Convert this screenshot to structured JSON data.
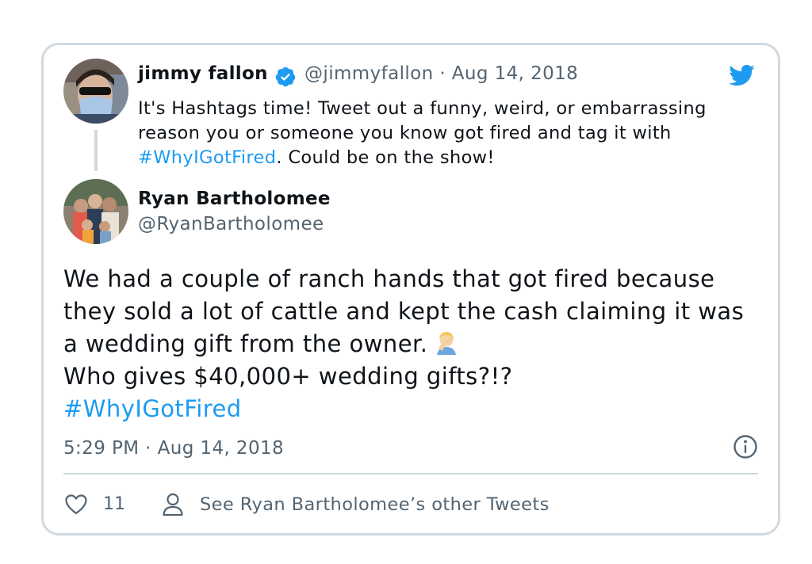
{
  "parent_tweet": {
    "author_name": "jimmy fallon",
    "meta": "@jimmyfallon · Aug 14, 2018",
    "text_before_tag": "It's Hashtags time! Tweet out a funny, weird, or embarrassing reason you or someone you know got fired and tag it with ",
    "hashtag": "#WhyIGotFired",
    "text_after_tag": ". Could be on the show!"
  },
  "reply_tweet": {
    "author_name": "Ryan Bartholomee",
    "handle": "@RyanBartholomee",
    "text_part1": "We had a couple of ranch hands that got fired because they sold a lot of cattle and kept the cash claiming it was a wedding gift from the owner.",
    "text_part2": "Who gives $40,000+ wedding gifts?!?",
    "hashtag": "#WhyIGotFired",
    "timestamp": "5:29 PM · Aug 14, 2018",
    "like_count": "11",
    "see_more_label": "See Ryan Bartholomee’s other Tweets"
  },
  "icons": {
    "brand": "twitter-bird-icon",
    "verified": "verified-badge-icon",
    "emoji": "facepalm-emoji",
    "info": "info-icon",
    "like": "heart-icon",
    "profile": "person-icon"
  },
  "colors": {
    "link": "#1d9bf0",
    "muted_text": "#536471",
    "border": "#cfd9de",
    "text": "#0f1419"
  }
}
